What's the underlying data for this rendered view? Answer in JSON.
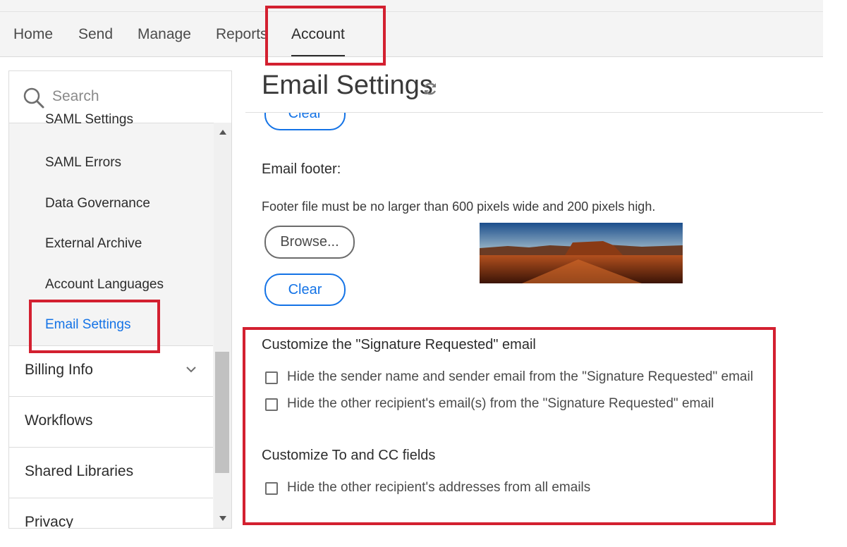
{
  "nav": {
    "items": [
      {
        "label": "Home"
      },
      {
        "label": "Send"
      },
      {
        "label": "Manage"
      },
      {
        "label": "Reports"
      },
      {
        "label": "Account"
      }
    ],
    "active": "Account"
  },
  "sidebar": {
    "search_placeholder": "Search",
    "sub_items": [
      {
        "label": "SAML Settings"
      },
      {
        "label": "SAML Errors"
      },
      {
        "label": "Data Governance"
      },
      {
        "label": "External Archive"
      },
      {
        "label": "Account Languages"
      },
      {
        "label": "Email Settings"
      }
    ],
    "active_sub_item": "Email Settings",
    "sections": [
      {
        "label": "Billing Info",
        "expandable": true,
        "icon": "chevron-down-icon"
      },
      {
        "label": "Workflows"
      },
      {
        "label": "Shared Libraries"
      },
      {
        "label": "Privacy"
      }
    ]
  },
  "main": {
    "title": "Email Settings",
    "title_icon": "refresh-icon",
    "clear_label": "Clear",
    "footer": {
      "label": "Email footer:",
      "hint": "Footer file must be no larger than 600 pixels wide and 200 pixels high.",
      "browse_label": "Browse...",
      "clear_label": "Clear",
      "image": "desert-mesa-landscape"
    },
    "signature_section": {
      "title": "Customize the \"Signature Requested\" email",
      "options": [
        {
          "label": "Hide the sender name and sender email from the \"Signature Requested\" email",
          "checked": false
        },
        {
          "label": "Hide the other recipient's email(s) from the \"Signature Requested\" email",
          "checked": false
        }
      ]
    },
    "to_cc_section": {
      "title": "Customize To and CC fields",
      "options": [
        {
          "label": "Hide the other recipient's addresses from all emails",
          "checked": false
        }
      ]
    }
  },
  "colors": {
    "accent": "#1473e6",
    "highlight": "#d32030",
    "nav_bg": "#f4f4f4"
  }
}
